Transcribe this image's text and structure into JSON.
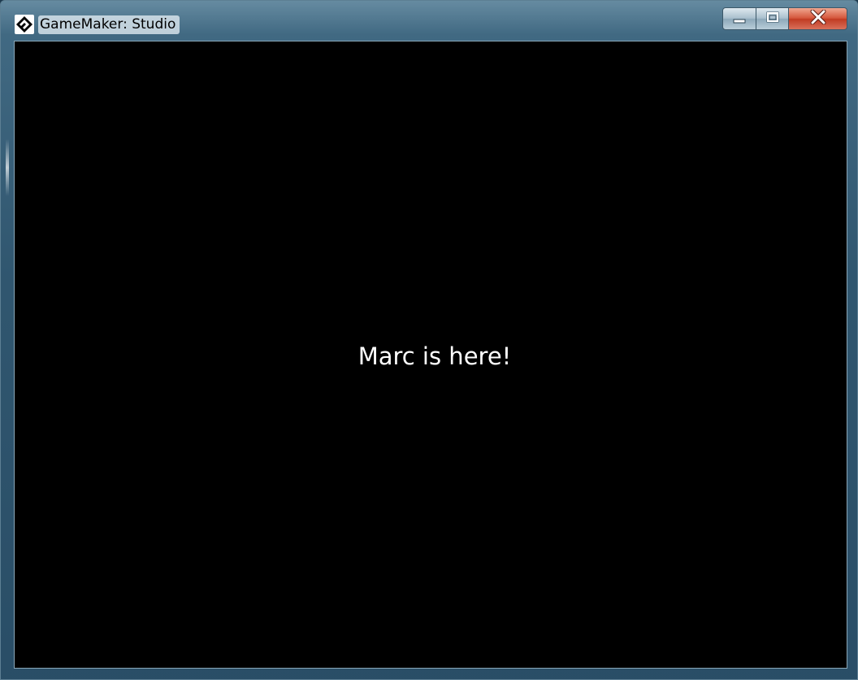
{
  "window": {
    "title": "GameMaker: Studio",
    "icon": "gamemaker-logo-icon"
  },
  "controls": {
    "minimize_icon": "minimize-icon",
    "maximize_icon": "maximize-icon",
    "close_icon": "close-icon"
  },
  "game": {
    "message": "Marc is here!",
    "background_color": "#000000",
    "text_color": "#ffffff"
  },
  "colors": {
    "close_button": "#c13b22",
    "frame": "#46708a"
  }
}
